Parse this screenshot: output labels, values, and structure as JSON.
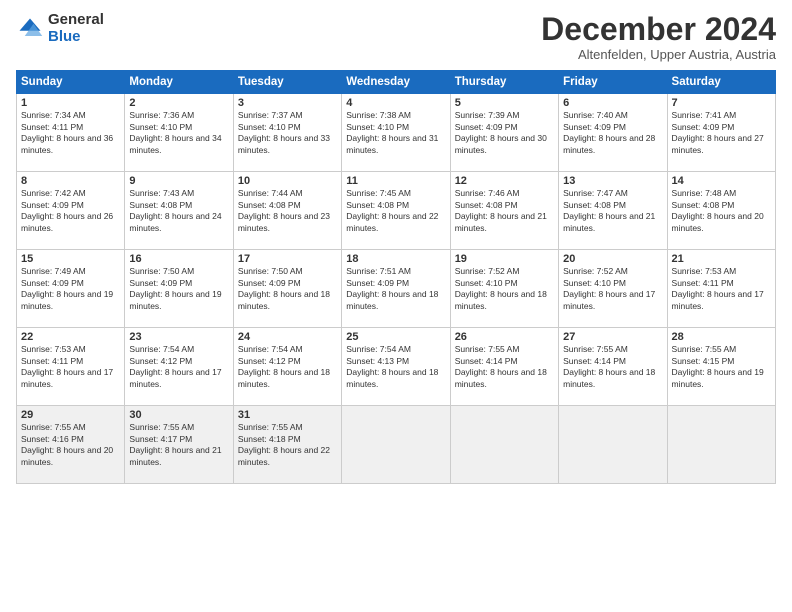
{
  "logo": {
    "general": "General",
    "blue": "Blue"
  },
  "title": "December 2024",
  "subtitle": "Altenfelden, Upper Austria, Austria",
  "days_header": [
    "Sunday",
    "Monday",
    "Tuesday",
    "Wednesday",
    "Thursday",
    "Friday",
    "Saturday"
  ],
  "weeks": [
    [
      {
        "day": "1",
        "rise": "Sunrise: 7:34 AM",
        "set": "Sunset: 4:11 PM",
        "daylight": "Daylight: 8 hours and 36 minutes."
      },
      {
        "day": "2",
        "rise": "Sunrise: 7:36 AM",
        "set": "Sunset: 4:10 PM",
        "daylight": "Daylight: 8 hours and 34 minutes."
      },
      {
        "day": "3",
        "rise": "Sunrise: 7:37 AM",
        "set": "Sunset: 4:10 PM",
        "daylight": "Daylight: 8 hours and 33 minutes."
      },
      {
        "day": "4",
        "rise": "Sunrise: 7:38 AM",
        "set": "Sunset: 4:10 PM",
        "daylight": "Daylight: 8 hours and 31 minutes."
      },
      {
        "day": "5",
        "rise": "Sunrise: 7:39 AM",
        "set": "Sunset: 4:09 PM",
        "daylight": "Daylight: 8 hours and 30 minutes."
      },
      {
        "day": "6",
        "rise": "Sunrise: 7:40 AM",
        "set": "Sunset: 4:09 PM",
        "daylight": "Daylight: 8 hours and 28 minutes."
      },
      {
        "day": "7",
        "rise": "Sunrise: 7:41 AM",
        "set": "Sunset: 4:09 PM",
        "daylight": "Daylight: 8 hours and 27 minutes."
      }
    ],
    [
      {
        "day": "8",
        "rise": "Sunrise: 7:42 AM",
        "set": "Sunset: 4:09 PM",
        "daylight": "Daylight: 8 hours and 26 minutes."
      },
      {
        "day": "9",
        "rise": "Sunrise: 7:43 AM",
        "set": "Sunset: 4:08 PM",
        "daylight": "Daylight: 8 hours and 24 minutes."
      },
      {
        "day": "10",
        "rise": "Sunrise: 7:44 AM",
        "set": "Sunset: 4:08 PM",
        "daylight": "Daylight: 8 hours and 23 minutes."
      },
      {
        "day": "11",
        "rise": "Sunrise: 7:45 AM",
        "set": "Sunset: 4:08 PM",
        "daylight": "Daylight: 8 hours and 22 minutes."
      },
      {
        "day": "12",
        "rise": "Sunrise: 7:46 AM",
        "set": "Sunset: 4:08 PM",
        "daylight": "Daylight: 8 hours and 21 minutes."
      },
      {
        "day": "13",
        "rise": "Sunrise: 7:47 AM",
        "set": "Sunset: 4:08 PM",
        "daylight": "Daylight: 8 hours and 21 minutes."
      },
      {
        "day": "14",
        "rise": "Sunrise: 7:48 AM",
        "set": "Sunset: 4:08 PM",
        "daylight": "Daylight: 8 hours and 20 minutes."
      }
    ],
    [
      {
        "day": "15",
        "rise": "Sunrise: 7:49 AM",
        "set": "Sunset: 4:09 PM",
        "daylight": "Daylight: 8 hours and 19 minutes."
      },
      {
        "day": "16",
        "rise": "Sunrise: 7:50 AM",
        "set": "Sunset: 4:09 PM",
        "daylight": "Daylight: 8 hours and 19 minutes."
      },
      {
        "day": "17",
        "rise": "Sunrise: 7:50 AM",
        "set": "Sunset: 4:09 PM",
        "daylight": "Daylight: 8 hours and 18 minutes."
      },
      {
        "day": "18",
        "rise": "Sunrise: 7:51 AM",
        "set": "Sunset: 4:09 PM",
        "daylight": "Daylight: 8 hours and 18 minutes."
      },
      {
        "day": "19",
        "rise": "Sunrise: 7:52 AM",
        "set": "Sunset: 4:10 PM",
        "daylight": "Daylight: 8 hours and 18 minutes."
      },
      {
        "day": "20",
        "rise": "Sunrise: 7:52 AM",
        "set": "Sunset: 4:10 PM",
        "daylight": "Daylight: 8 hours and 17 minutes."
      },
      {
        "day": "21",
        "rise": "Sunrise: 7:53 AM",
        "set": "Sunset: 4:11 PM",
        "daylight": "Daylight: 8 hours and 17 minutes."
      }
    ],
    [
      {
        "day": "22",
        "rise": "Sunrise: 7:53 AM",
        "set": "Sunset: 4:11 PM",
        "daylight": "Daylight: 8 hours and 17 minutes."
      },
      {
        "day": "23",
        "rise": "Sunrise: 7:54 AM",
        "set": "Sunset: 4:12 PM",
        "daylight": "Daylight: 8 hours and 17 minutes."
      },
      {
        "day": "24",
        "rise": "Sunrise: 7:54 AM",
        "set": "Sunset: 4:12 PM",
        "daylight": "Daylight: 8 hours and 18 minutes."
      },
      {
        "day": "25",
        "rise": "Sunrise: 7:54 AM",
        "set": "Sunset: 4:13 PM",
        "daylight": "Daylight: 8 hours and 18 minutes."
      },
      {
        "day": "26",
        "rise": "Sunrise: 7:55 AM",
        "set": "Sunset: 4:14 PM",
        "daylight": "Daylight: 8 hours and 18 minutes."
      },
      {
        "day": "27",
        "rise": "Sunrise: 7:55 AM",
        "set": "Sunset: 4:14 PM",
        "daylight": "Daylight: 8 hours and 18 minutes."
      },
      {
        "day": "28",
        "rise": "Sunrise: 7:55 AM",
        "set": "Sunset: 4:15 PM",
        "daylight": "Daylight: 8 hours and 19 minutes."
      }
    ],
    [
      {
        "day": "29",
        "rise": "Sunrise: 7:55 AM",
        "set": "Sunset: 4:16 PM",
        "daylight": "Daylight: 8 hours and 20 minutes."
      },
      {
        "day": "30",
        "rise": "Sunrise: 7:55 AM",
        "set": "Sunset: 4:17 PM",
        "daylight": "Daylight: 8 hours and 21 minutes."
      },
      {
        "day": "31",
        "rise": "Sunrise: 7:55 AM",
        "set": "Sunset: 4:18 PM",
        "daylight": "Daylight: 8 hours and 22 minutes."
      },
      null,
      null,
      null,
      null
    ]
  ]
}
